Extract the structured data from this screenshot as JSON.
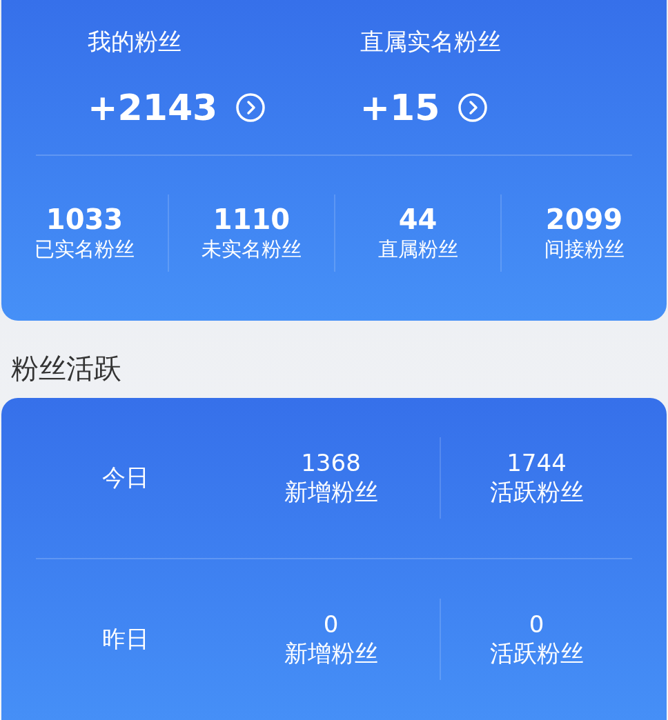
{
  "summary": {
    "headline": [
      {
        "label": "我的粉丝",
        "value": "+2143"
      },
      {
        "label": "直属实名粉丝",
        "value": "+15"
      }
    ],
    "stats": [
      {
        "value": "1033",
        "label": "已实名粉丝"
      },
      {
        "value": "1110",
        "label": "未实名粉丝"
      },
      {
        "value": "44",
        "label": "直属粉丝"
      },
      {
        "value": "2099",
        "label": "间接粉丝"
      }
    ]
  },
  "activity": {
    "title": "粉丝活跃",
    "rows": [
      {
        "day": "今日",
        "stats": [
          {
            "value": "1368",
            "label": "新增粉丝"
          },
          {
            "value": "1744",
            "label": "活跃粉丝"
          }
        ]
      },
      {
        "day": "昨日",
        "stats": [
          {
            "value": "0",
            "label": "新增粉丝"
          },
          {
            "value": "0",
            "label": "活跃粉丝"
          }
        ]
      }
    ]
  }
}
